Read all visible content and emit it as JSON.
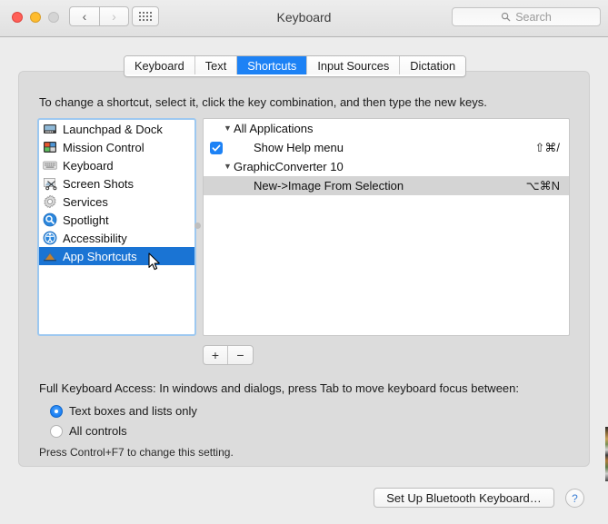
{
  "window": {
    "title": "Keyboard",
    "traffic_lights": [
      "close",
      "minimize",
      "zoom"
    ],
    "nav_back_icon": "chevron-left-icon",
    "nav_forward_icon": "chevron-right-icon",
    "grid_icon": "show-all-preferences-icon",
    "search": {
      "placeholder": "Search",
      "icon": "search-icon"
    }
  },
  "tabs": [
    {
      "label": "Keyboard",
      "active": false
    },
    {
      "label": "Text",
      "active": false
    },
    {
      "label": "Shortcuts",
      "active": true
    },
    {
      "label": "Input Sources",
      "active": false
    },
    {
      "label": "Dictation",
      "active": false
    }
  ],
  "content": {
    "instruction": "To change a shortcut, select it, click the key combination, and then type the new keys.",
    "categories": [
      {
        "label": "Launchpad & Dock",
        "icon": "launchpad-dock-icon",
        "selected": false
      },
      {
        "label": "Mission Control",
        "icon": "mission-control-icon",
        "selected": false
      },
      {
        "label": "Keyboard",
        "icon": "keyboard-icon",
        "selected": false
      },
      {
        "label": "Screen Shots",
        "icon": "screen-shots-icon",
        "selected": false
      },
      {
        "label": "Services",
        "icon": "services-gear-icon",
        "selected": false
      },
      {
        "label": "Spotlight",
        "icon": "spotlight-icon",
        "selected": false
      },
      {
        "label": "Accessibility",
        "icon": "accessibility-icon",
        "selected": false
      },
      {
        "label": "App Shortcuts",
        "icon": "app-shortcuts-icon",
        "selected": true
      }
    ],
    "shortcuts": [
      {
        "type": "group",
        "label": "All Applications",
        "expanded": true,
        "disclosure": "▼"
      },
      {
        "type": "item",
        "label": "Show Help menu",
        "key": "⇧⌘/",
        "checked": true,
        "selected": false
      },
      {
        "type": "group",
        "label": "GraphicConverter 10",
        "expanded": true,
        "disclosure": "▼"
      },
      {
        "type": "item",
        "label": "New->Image From Selection",
        "key": "⌥⌘N",
        "checked": false,
        "selected": true
      }
    ],
    "add_button_label": "+",
    "remove_button_label": "−",
    "full_keyboard_access_label": "Full Keyboard Access: In windows and dialogs, press Tab to move keyboard focus between:",
    "radio_options": [
      {
        "label": "Text boxes and lists only",
        "selected": true
      },
      {
        "label": "All controls",
        "selected": false
      }
    ],
    "hint": "Press Control+F7 to change this setting."
  },
  "footer": {
    "bluetooth_button_label": "Set Up Bluetooth Keyboard…",
    "help_button_label": "?"
  },
  "colors": {
    "accent_blue": "#1d82f5",
    "selection_blue": "#1a74d4",
    "row_selection_grey": "#d4d4d4",
    "window_bg": "#ececec",
    "panel_bg": "#dcdcdc",
    "focus_ring": "#9dc8f0"
  }
}
